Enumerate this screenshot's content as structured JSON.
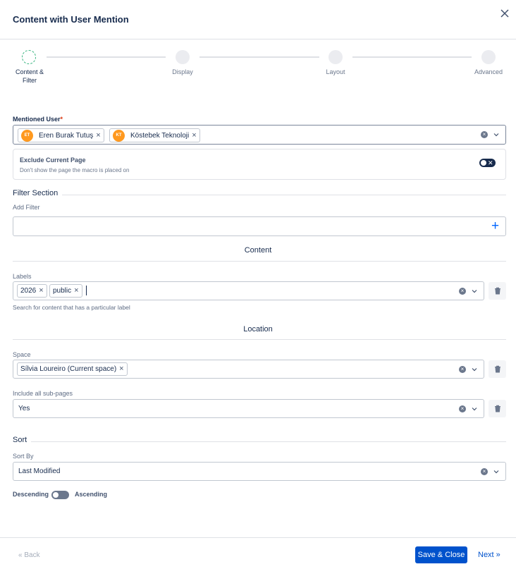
{
  "dialog": {
    "title": "Content with User Mention"
  },
  "stepper": {
    "steps": [
      {
        "label": "Content &\nFilter",
        "active": true
      },
      {
        "label": "Display",
        "active": false
      },
      {
        "label": "Layout",
        "active": false
      },
      {
        "label": "Advanced",
        "active": false
      }
    ]
  },
  "mentioned_user": {
    "label": "Mentioned User",
    "required_mark": "*",
    "users": [
      {
        "initials": "ET",
        "name": "Eren Burak Tutuş"
      },
      {
        "initials": "KT",
        "name": "Köstebek Teknoloji"
      }
    ]
  },
  "exclude_current": {
    "title": "Exclude Current Page",
    "subtitle": "Don't show the page the macro is placed on",
    "toggle_mark": "✕"
  },
  "filter_section": {
    "title": "Filter Section",
    "add_filter_label": "Add Filter",
    "add_icon": "+"
  },
  "content_group": {
    "title": "Content",
    "labels_label": "Labels",
    "labels": [
      "2026",
      "public"
    ],
    "hint": "Search for content that has a particular label"
  },
  "location_group": {
    "title": "Location",
    "space_label": "Space",
    "space_value": "Sílvia Loureiro (Current space)",
    "subpages_label": "Include all sub-pages",
    "subpages_value": "Yes"
  },
  "sort": {
    "title": "Sort",
    "sort_by_label": "Sort By",
    "sort_by_value": "Last Modified",
    "descending": "Descending",
    "ascending": "Ascending"
  },
  "footer": {
    "back": "« Back",
    "save": "Save & Close",
    "next": "Next »"
  },
  "colors": {
    "primary": "#0052cc",
    "avatar": "#ff991f",
    "active_step": "#36b37e"
  }
}
